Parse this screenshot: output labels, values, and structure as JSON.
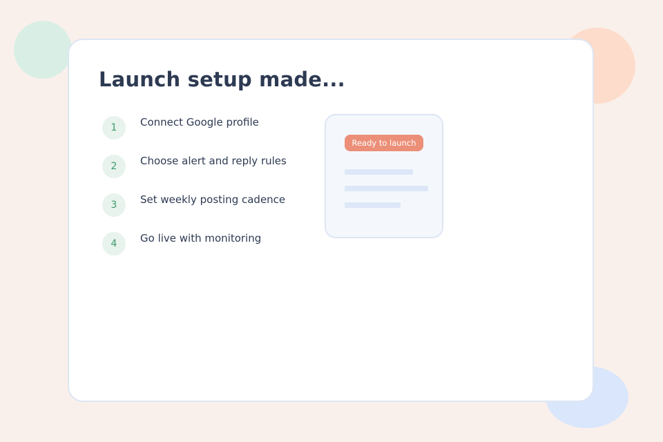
{
  "title": "Launch setup made...",
  "steps": [
    {
      "number": "1",
      "label": "Connect Google profile"
    },
    {
      "number": "2",
      "label": "Choose alert and reply rules"
    },
    {
      "number": "3",
      "label": "Set weekly posting cadence"
    },
    {
      "number": "4",
      "label": "Go live with monitoring"
    }
  ],
  "preview": {
    "badge": "Ready to launch"
  },
  "colors": {
    "background": "#faf0eb",
    "title": "#2d3a52",
    "step_accent": "#3e9a6a",
    "badge": "#ec8f78"
  }
}
